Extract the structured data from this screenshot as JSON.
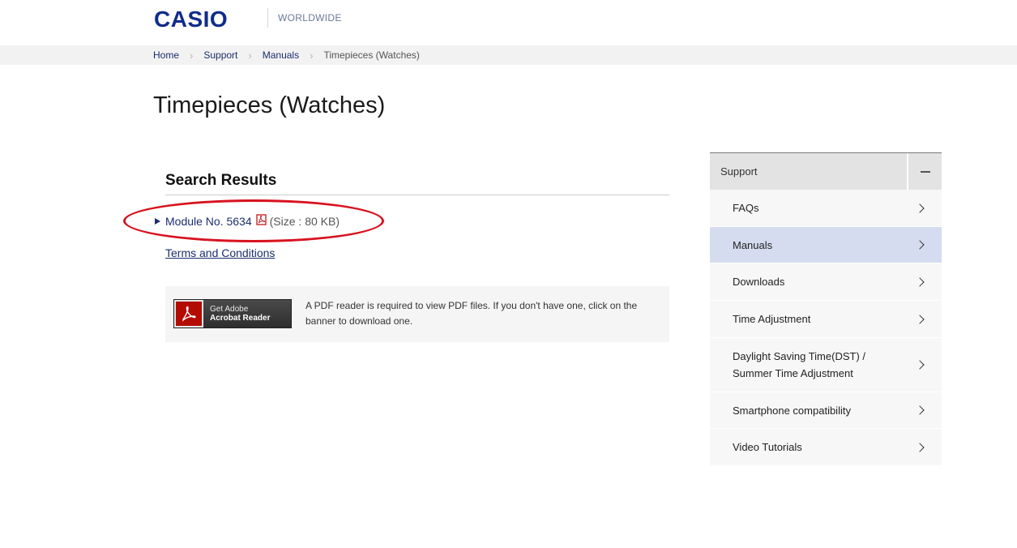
{
  "header": {
    "logo_text": "CASIO",
    "region": "WORLDWIDE",
    "brand_color": "#0f2b8c"
  },
  "breadcrumb": {
    "items": [
      "Home",
      "Support",
      "Manuals",
      "Timepieces (Watches)"
    ]
  },
  "page": {
    "title": "Timepieces (Watches)"
  },
  "results": {
    "heading": "Search Results",
    "items": [
      {
        "label": "Module No. 5634",
        "size": "(Size : 80 KB)",
        "icon": "pdf-icon"
      }
    ],
    "highlight_color": "#d8121f"
  },
  "terms_link": "Terms and Conditions",
  "pdf_reader": {
    "banner_line1": "Get Adobe",
    "banner_line2": "Acrobat Reader",
    "note": "A PDF reader is required to view PDF files. If you don't have one, click on the banner to download one."
  },
  "sidebar": {
    "heading": "Support",
    "items": [
      {
        "label": "FAQs",
        "active": false
      },
      {
        "label": "Manuals",
        "active": true
      },
      {
        "label": "Downloads",
        "active": false
      },
      {
        "label": "Time Adjustment",
        "active": false
      },
      {
        "label_line1": "Daylight Saving Time(DST) /",
        "label_line2": "Summer Time Adjustment",
        "active": false
      },
      {
        "label": "Smartphone compatibility",
        "active": false
      },
      {
        "label": "Video Tutorials",
        "active": false
      }
    ]
  }
}
